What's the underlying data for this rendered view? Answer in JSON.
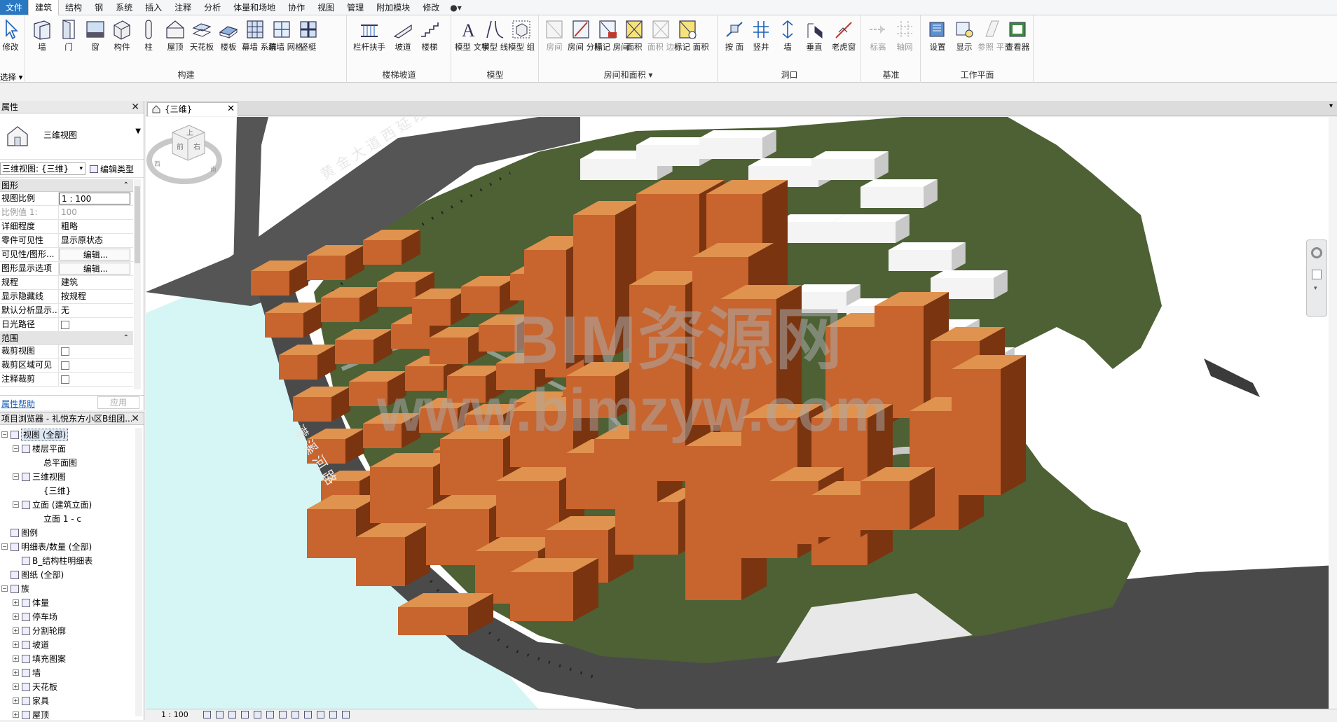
{
  "menubar": {
    "items": [
      "文件",
      "建筑",
      "结构",
      "钢",
      "系统",
      "插入",
      "注释",
      "分析",
      "体量和场地",
      "协作",
      "视图",
      "管理",
      "附加模块",
      "修改",
      "●▾"
    ]
  },
  "ribbon": {
    "groups": [
      {
        "title": "构建"
      },
      {
        "title": "楼梯坡道"
      },
      {
        "title": "模型"
      },
      {
        "title": "房间和面积 ▾"
      },
      {
        "title": "洞口"
      },
      {
        "title": "基准"
      },
      {
        "title": "工作平面"
      }
    ],
    "select_label": "选择 ▾",
    "buttons": {
      "modify": "修改",
      "wall": "墙",
      "door": "门",
      "window": "窗",
      "component": "构件",
      "column": "柱",
      "roof": "屋顶",
      "ceiling": "天花板",
      "floor": "楼板",
      "curtain_system": "幕墙 系统",
      "curtain_grid": "幕墙 网格",
      "mullion": "竖梃",
      "railing": "栏杆扶手",
      "ramp": "坡道",
      "stair": "楼梯",
      "model_text": "模型 文字",
      "model_line": "模型 线",
      "model_group": "模型 组",
      "room": "房间",
      "room_separator": "房间 分隔",
      "tag_room": "标记 房间",
      "area": "面积",
      "area_boundary": "面积 边界",
      "tag_area": "标记 面积",
      "by_face": "按 面",
      "shaft": "竖井",
      "wall_opening": "墙",
      "vertical": "垂直",
      "dormer": "老虎窗",
      "level": "标高",
      "grid": "轴网",
      "set": "设置",
      "show": "显示",
      "ref_plane": "参照 平面",
      "viewer": "查看器"
    }
  },
  "properties": {
    "title": "属性",
    "type_name": "三维视图",
    "view_selector": "三维视图: {三维}",
    "edit_type": "编辑类型",
    "section_graphics": "图形",
    "section_extents": "范围",
    "rows": [
      {
        "k": "视图比例",
        "v": "1 : 100"
      },
      {
        "k": "比例值 1:",
        "v": "100"
      },
      {
        "k": "详细程度",
        "v": "粗略"
      },
      {
        "k": "零件可见性",
        "v": "显示原状态"
      },
      {
        "k": "可见性/图形...",
        "v": "编辑..."
      },
      {
        "k": "图形显示选项",
        "v": "编辑..."
      },
      {
        "k": "规程",
        "v": "建筑"
      },
      {
        "k": "显示隐藏线",
        "v": "按规程"
      },
      {
        "k": "默认分析显示...",
        "v": "无"
      },
      {
        "k": "日光路径",
        "v": ""
      }
    ],
    "extent_rows": [
      {
        "k": "裁剪视图"
      },
      {
        "k": "裁剪区域可见"
      },
      {
        "k": "注释裁剪"
      }
    ],
    "help": "属性帮助",
    "apply": "应用"
  },
  "browser": {
    "title": "项目浏览器 - 礼悦东方小区B组团...",
    "nodes": [
      {
        "label": "视图 (全部)",
        "depth": 0,
        "pm": "-",
        "sel": true
      },
      {
        "label": "楼层平面",
        "depth": 1,
        "pm": "-"
      },
      {
        "label": "总平面图",
        "depth": 2,
        "pm": ""
      },
      {
        "label": "三维视图",
        "depth": 1,
        "pm": "-"
      },
      {
        "label": "{三维}",
        "depth": 2,
        "pm": ""
      },
      {
        "label": "立面 (建筑立面)",
        "depth": 1,
        "pm": "-"
      },
      {
        "label": "立面 1 - c",
        "depth": 2,
        "pm": ""
      },
      {
        "label": "图例",
        "depth": 0,
        "pm": ""
      },
      {
        "label": "明细表/数量 (全部)",
        "depth": 0,
        "pm": "-"
      },
      {
        "label": "B_结构柱明细表",
        "depth": 1,
        "pm": ""
      },
      {
        "label": "图纸 (全部)",
        "depth": 0,
        "pm": ""
      },
      {
        "label": "族",
        "depth": 0,
        "pm": "-"
      },
      {
        "label": "体量",
        "depth": 1,
        "pm": "+"
      },
      {
        "label": "停车场",
        "depth": 1,
        "pm": "+"
      },
      {
        "label": "分割轮廓",
        "depth": 1,
        "pm": "+"
      },
      {
        "label": "坡道",
        "depth": 1,
        "pm": "+"
      },
      {
        "label": "填充图案",
        "depth": 1,
        "pm": "+"
      },
      {
        "label": "墙",
        "depth": 1,
        "pm": "+"
      },
      {
        "label": "天花板",
        "depth": 1,
        "pm": "+"
      },
      {
        "label": "家具",
        "depth": 1,
        "pm": "+"
      },
      {
        "label": "屋顶",
        "depth": 1,
        "pm": "+"
      }
    ]
  },
  "view": {
    "tab_label": "{三维}",
    "road_label_1": "黄 金 大 道 西 延 段",
    "road_label_2": "濛 溪 河 路",
    "watermark_1": "BIM资源网",
    "watermark_2": "www.bimzyw.com",
    "viewcube_top": "上",
    "viewcube_front": "前",
    "viewcube_right": "右",
    "viewcube_ring_1": "西",
    "viewcube_ring_2": "南"
  },
  "statusbar": {
    "scale": "1 : 100"
  },
  "colors": {
    "building": "#c8642e",
    "building_dark": "#7a3410",
    "grass": "#4d6134",
    "road": "#555555",
    "water": "#d6f6f6",
    "massing": "#f2f2f2",
    "accent": "#2a78c2"
  }
}
